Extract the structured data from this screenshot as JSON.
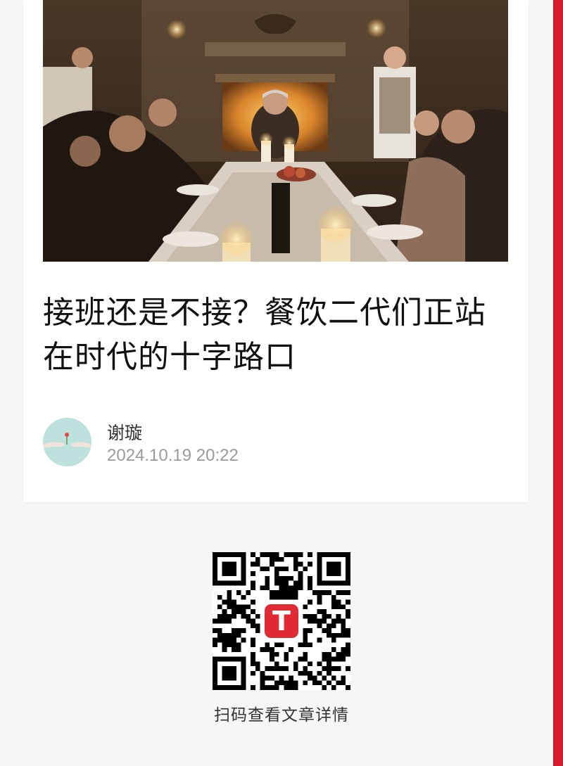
{
  "article": {
    "title": "接班还是不接？餐饮二代们正站在时代的十字路口",
    "hero_image": "family-dinner-table-photo"
  },
  "author": {
    "name": "谢璇",
    "date": "2024.10.19 20:22",
    "avatar": "hands-passing-flower-avatar"
  },
  "qr": {
    "caption": "扫码查看文章详情",
    "logo_letter": "T"
  },
  "colors": {
    "accent": "#d51c2c",
    "logo": "#e02a36",
    "background": "#f6f6f6",
    "card": "#ffffff"
  }
}
